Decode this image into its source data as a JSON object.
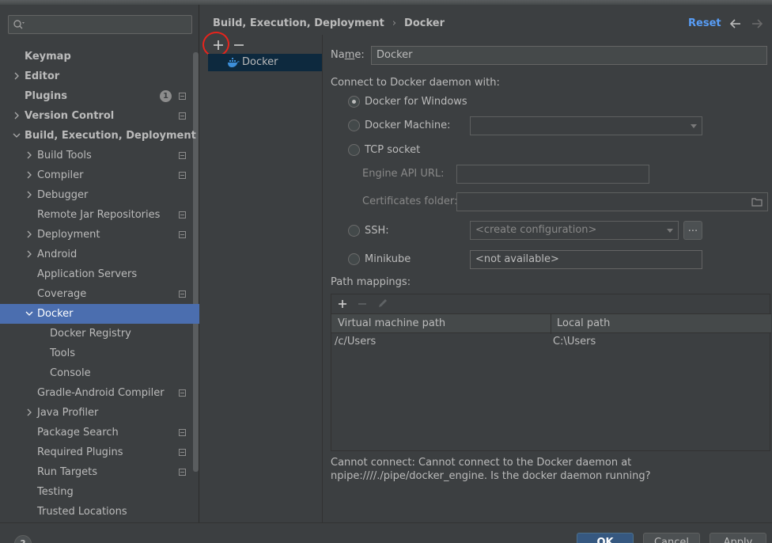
{
  "header": {
    "breadcrumb": [
      "Build, Execution, Deployment",
      "Docker"
    ],
    "reset_label": "Reset"
  },
  "sidebar": {
    "search_placeholder": "",
    "items": [
      {
        "label": "Keymap",
        "bold": true
      },
      {
        "label": "Editor",
        "bold": true,
        "chevron": "right"
      },
      {
        "label": "Plugins",
        "bold": true,
        "badge": "1"
      },
      {
        "label": "Version Control",
        "bold": true,
        "chevron": "right"
      },
      {
        "label": "Build, Execution, Deployment",
        "bold": true,
        "chevron": "down"
      },
      {
        "label": "Build Tools",
        "chevron": "right"
      },
      {
        "label": "Compiler",
        "chevron": "right"
      },
      {
        "label": "Debugger",
        "chevron": "right"
      },
      {
        "label": "Remote Jar Repositories"
      },
      {
        "label": "Deployment",
        "chevron": "right"
      },
      {
        "label": "Android",
        "chevron": "right"
      },
      {
        "label": "Application Servers"
      },
      {
        "label": "Coverage"
      },
      {
        "label": "Docker",
        "chevron": "down",
        "selected": true
      },
      {
        "label": "Docker Registry"
      },
      {
        "label": "Tools"
      },
      {
        "label": "Console"
      },
      {
        "label": "Gradle-Android Compiler"
      },
      {
        "label": "Java Profiler",
        "chevron": "right"
      },
      {
        "label": "Package Search"
      },
      {
        "label": "Required Plugins"
      },
      {
        "label": "Run Targets"
      },
      {
        "label": "Testing"
      },
      {
        "label": "Trusted Locations"
      }
    ]
  },
  "list": {
    "add_symbol": "+",
    "remove_symbol": "−",
    "selected_item": "Docker"
  },
  "form": {
    "name_label_pre": "Na",
    "name_label_mnemonic": "m",
    "name_label_post": "e:",
    "name_value": "Docker",
    "connect_label": "Connect to Docker daemon with:",
    "opt_windows": "Docker for Windows",
    "opt_machine": "Docker Machine:",
    "opt_tcp": "TCP socket",
    "engine_api_label": "Engine API URL:",
    "engine_api_value": "",
    "certs_label": "Certificates folder:",
    "certs_value": "",
    "opt_ssh": "SSH:",
    "ssh_value": "<create configuration>",
    "ssh_more": "...",
    "opt_minikube": "Minikube",
    "minikube_value": "<not available>",
    "path_mappings_label": "Path mappings:"
  },
  "mappings": {
    "col1": "Virtual machine path",
    "col2": "Local path",
    "rows": [
      {
        "vm": "/c/Users",
        "local": "C:\\Users"
      }
    ]
  },
  "error_text": "Cannot connect: Cannot connect to the Docker daemon at npipe:////./pipe/docker_engine. Is the docker daemon running?",
  "buttons": {
    "help": "?",
    "ok": "OK",
    "cancel": "Cancel",
    "apply": "Apply"
  },
  "colors": {
    "accent": "#4b6eaf",
    "link": "#589df6",
    "annotation": "#e8241c"
  }
}
